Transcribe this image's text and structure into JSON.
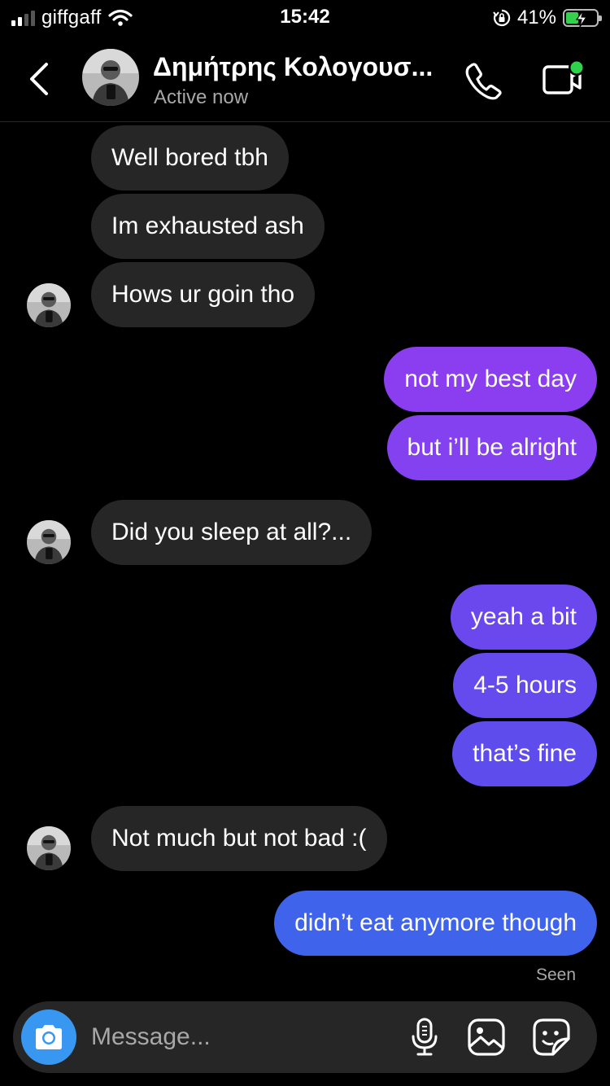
{
  "status_bar": {
    "carrier": "giffgaff",
    "time": "15:42",
    "battery_percent": "41%",
    "battery_level": 0.41,
    "charging": true,
    "signal_bars": 2,
    "icons": [
      "signal-icon",
      "wifi-icon",
      "orientation-lock-icon",
      "battery-icon"
    ]
  },
  "header": {
    "contact_name": "Δημήτρης Κολογουσ...",
    "status": "Active now",
    "icons": [
      "back-arrow-icon",
      "avatar",
      "phone-icon",
      "video-camera-icon"
    ],
    "online_color": "#2fd24b"
  },
  "messages": [
    {
      "from": "them",
      "text": "Well bored tbh"
    },
    {
      "from": "them",
      "text": "Im exhausted ash"
    },
    {
      "from": "them",
      "text": "Hows ur goin tho"
    },
    {
      "from": "me",
      "text": "not my best day"
    },
    {
      "from": "me",
      "text": "but i’ll be alright"
    },
    {
      "from": "them",
      "text": "Did you sleep at all?..."
    },
    {
      "from": "me",
      "text": "yeah a bit"
    },
    {
      "from": "me",
      "text": "4-5 hours"
    },
    {
      "from": "me",
      "text": "that’s fine"
    },
    {
      "from": "them",
      "text": "Not much but not bad :("
    },
    {
      "from": "me",
      "text": "didn’t eat anymore though"
    }
  ],
  "seen_label": "Seen",
  "composer": {
    "placeholder": "Message...",
    "icons": [
      "camera-icon",
      "microphone-icon",
      "gallery-icon",
      "sticker-icon"
    ]
  },
  "colors": {
    "incoming_bubble": "#262626",
    "outgoing_purple": "#8a3ef0",
    "outgoing_violet": "#6a48ee",
    "outgoing_blue": "#3f63ea",
    "camera_button": "#3897f0"
  }
}
